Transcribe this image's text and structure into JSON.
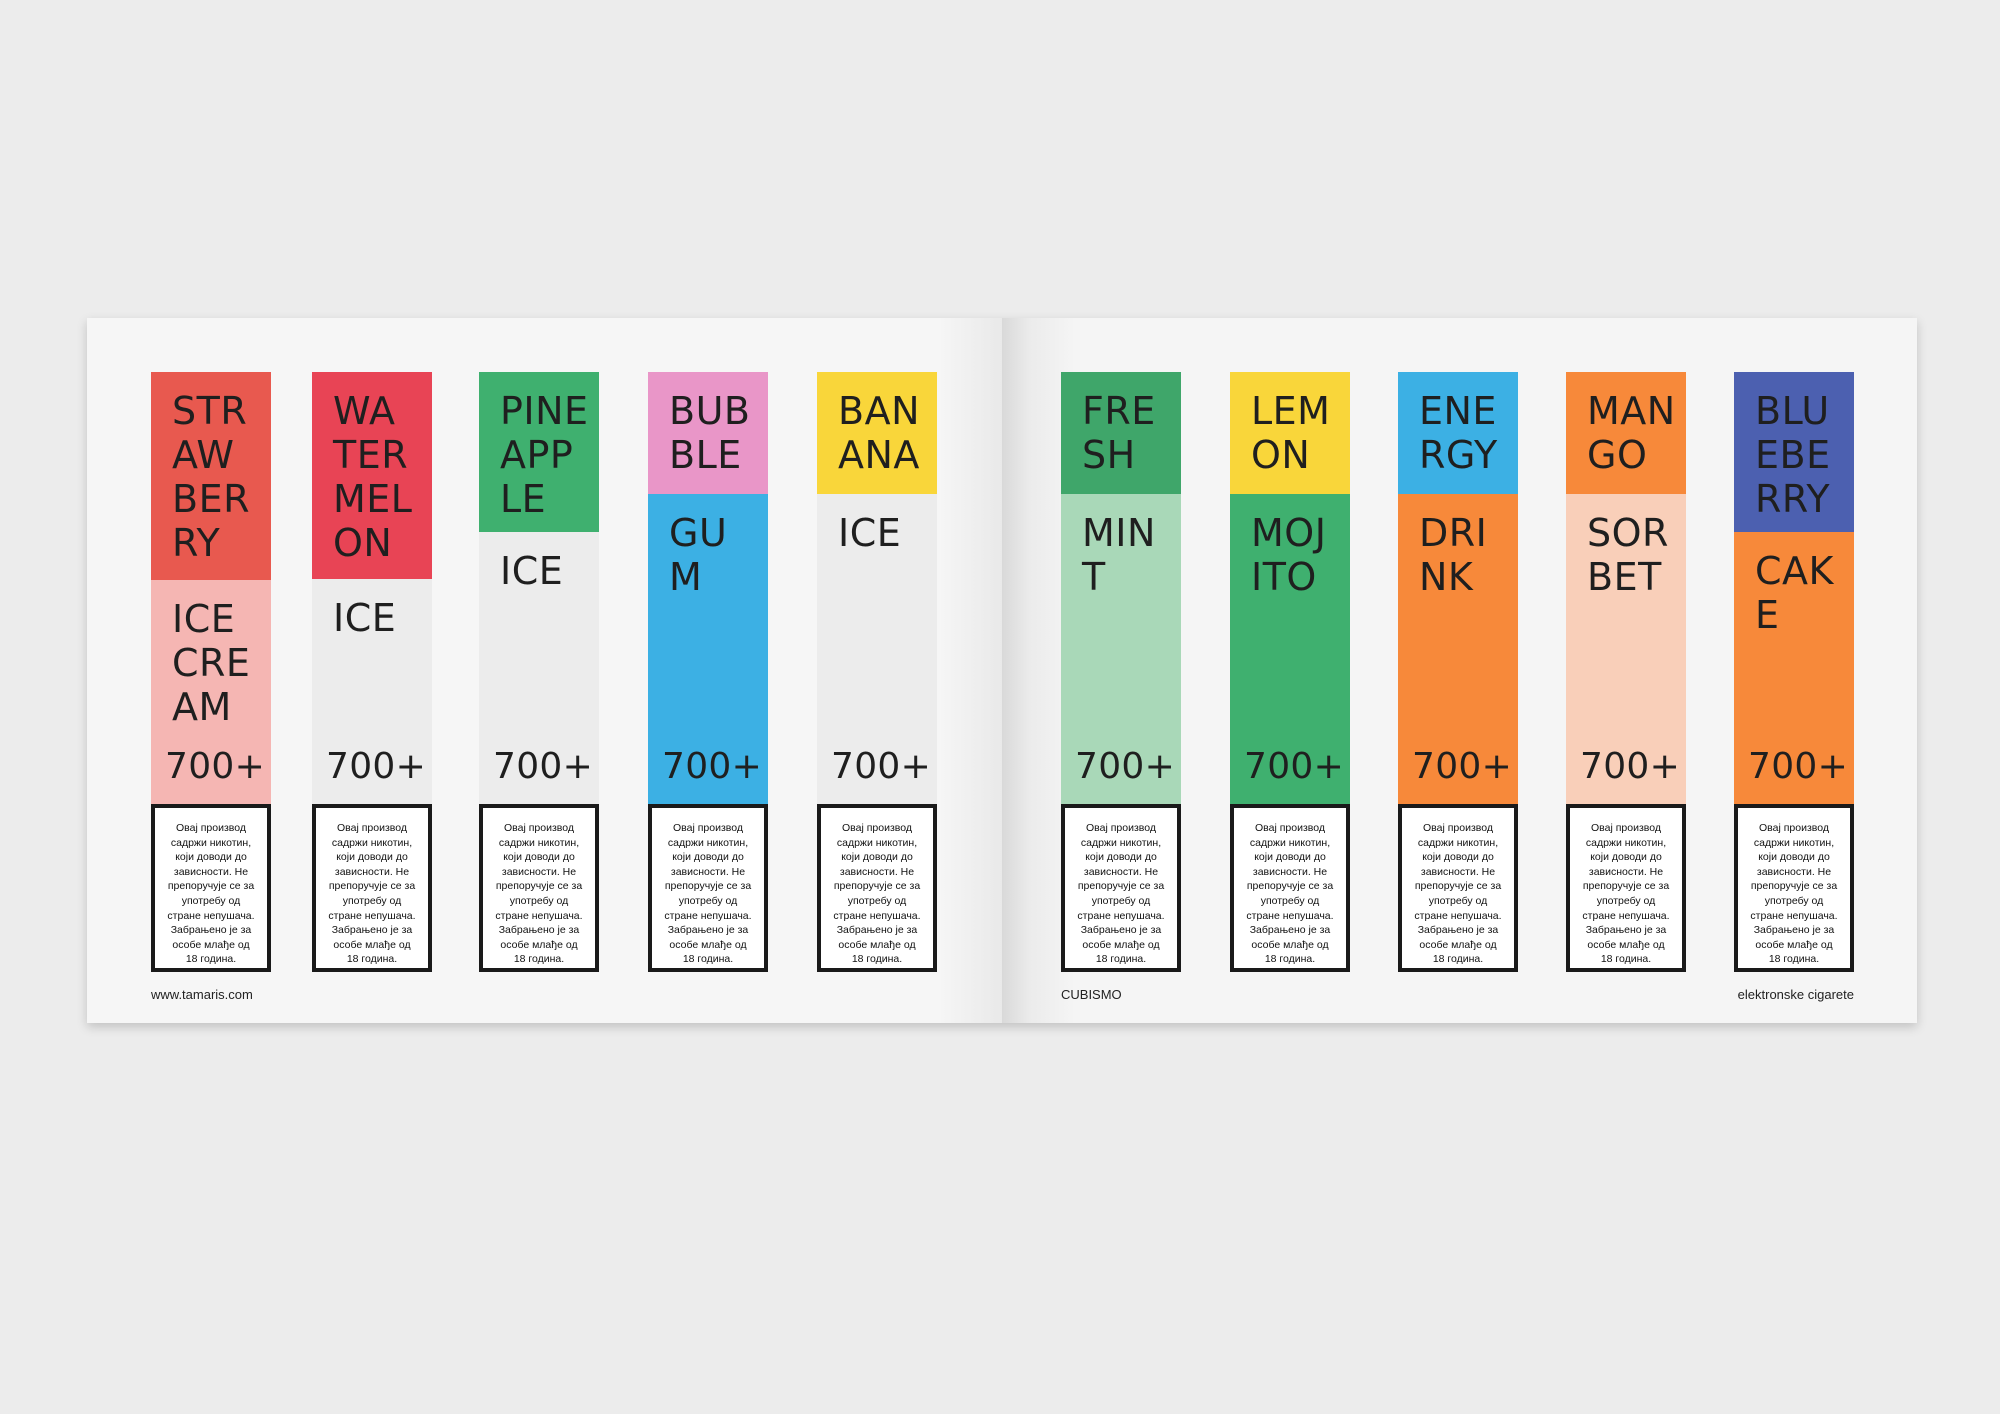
{
  "footer": {
    "website": "www.tamaris.com",
    "brand": "CUBISMO",
    "category": "elektronske cigarete"
  },
  "warning_text": "Овај производ\nсадржи никотин,\nкоји доводи до\nзависности. Не\nпрепоручује се за\nупотребу од\nстране непушача.\nЗабрањено је за\nособе млађе од\n18 година.",
  "colors": {
    "strawberry_top": "#e8594f",
    "strawberry_bottom": "#f5b6b3",
    "watermelon_top": "#e84455",
    "ice_bottom": "#ececec",
    "pineapple_top": "#3fb06f",
    "bubble_top": "#e996c8",
    "bubble_bottom": "#3cb0e4",
    "banana_top": "#f9d63a",
    "fresh_top": "#3fa66a",
    "fresh_bottom": "#a9d8b8",
    "lemon_top": "#f9d63a",
    "lemon_bottom": "#3fb06f",
    "energy_top": "#3cb0e4",
    "orange_bottom": "#f7893a",
    "mango_top": "#f7893a",
    "mango_bottom": "#f9cfb9",
    "blueberry_top": "#4c60b0",
    "blueberry_bottom": "#f7893a"
  },
  "products": [
    {
      "top": "STR\nAW\nBER\nRY",
      "bottom": "ICE\nCRE\nAM",
      "count": "700+"
    },
    {
      "top": "WA\nTER\nMEL\nON",
      "bottom": "ICE",
      "count": "700+"
    },
    {
      "top": "PINE\nAPP\nLE",
      "bottom": "ICE",
      "count": "700+"
    },
    {
      "top": "BUB\nBLE",
      "bottom": "GU\nM",
      "count": "700+"
    },
    {
      "top": "BAN\nANA",
      "bottom": "ICE",
      "count": "700+"
    },
    {
      "top": "FRE\nSH",
      "bottom": "MIN\nT",
      "count": "700+"
    },
    {
      "top": "LEM\nON",
      "bottom": "MOJ\nITO",
      "count": "700+"
    },
    {
      "top": "ENE\nRGY",
      "bottom": "DRI\nNK",
      "count": "700+"
    },
    {
      "top": "MAN\nGO",
      "bottom": "SOR\nBET",
      "count": "700+"
    },
    {
      "top": "BLU\nEBE\nRRY",
      "bottom": "CAK\nE",
      "count": "700+"
    }
  ]
}
